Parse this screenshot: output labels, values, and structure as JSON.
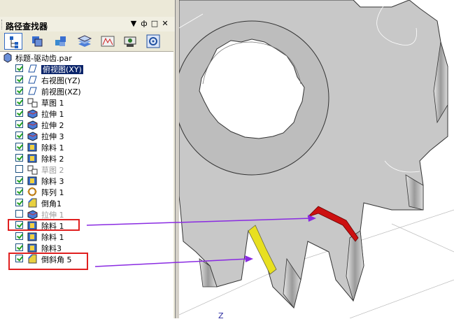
{
  "panel": {
    "title": "路径查找器",
    "title_buttons": [
      "▼",
      "ф",
      "□",
      "✕"
    ],
    "tools": [
      "feature-tree-icon",
      "layers-icon",
      "assembly-icon",
      "stack-icon",
      "variables-icon",
      "simulation-icon",
      "settings-icon"
    ]
  },
  "tree": {
    "root_label": "标题-驱动齿.par",
    "items": [
      {
        "label": "俯视图(XY)",
        "checked": true,
        "icon": "plane-icon",
        "selected": true,
        "dim": false
      },
      {
        "label": "右视图(YZ)",
        "checked": true,
        "icon": "plane-icon",
        "selected": false,
        "dim": false
      },
      {
        "label": "前视图(XZ)",
        "checked": true,
        "icon": "plane-icon",
        "selected": false,
        "dim": false
      },
      {
        "label": "草图 1",
        "checked": true,
        "icon": "sketch-icon",
        "selected": false,
        "dim": false
      },
      {
        "label": "拉伸 1",
        "checked": true,
        "icon": "extrude-icon",
        "selected": false,
        "dim": false
      },
      {
        "label": "拉伸 2",
        "checked": true,
        "icon": "extrude-icon",
        "selected": false,
        "dim": false
      },
      {
        "label": "拉伸 3",
        "checked": true,
        "icon": "extrude-icon",
        "selected": false,
        "dim": false
      },
      {
        "label": "除料 1",
        "checked": true,
        "icon": "cutout-icon",
        "selected": false,
        "dim": false
      },
      {
        "label": "除料 2",
        "checked": true,
        "icon": "cutout-icon",
        "selected": false,
        "dim": false
      },
      {
        "label": "草图 2",
        "checked": false,
        "icon": "sketch-icon",
        "selected": false,
        "dim": true
      },
      {
        "label": "除料 3",
        "checked": true,
        "icon": "cutout-icon",
        "selected": false,
        "dim": false
      },
      {
        "label": "阵列 1",
        "checked": true,
        "icon": "pattern-icon",
        "selected": false,
        "dim": false
      },
      {
        "label": "倒角1",
        "checked": true,
        "icon": "chamfer-icon",
        "selected": false,
        "dim": false
      },
      {
        "label": "拉伸 1",
        "checked": false,
        "icon": "extrude-icon",
        "selected": false,
        "dim": true
      },
      {
        "label": "除料 1",
        "checked": true,
        "icon": "cutout-icon",
        "selected": false,
        "dim": false
      },
      {
        "label": "除料 1",
        "checked": true,
        "icon": "cutout-icon",
        "selected": false,
        "dim": false
      },
      {
        "label": "除料3",
        "checked": true,
        "icon": "cutout-icon",
        "selected": false,
        "dim": false
      },
      {
        "label": "倒斜角 5",
        "checked": true,
        "icon": "chamfer-icon",
        "selected": false,
        "dim": false
      }
    ]
  },
  "viewport": {
    "axis_label": "Z",
    "highlight_red": "#cc1010",
    "highlight_yellow": "#e8e020",
    "gear_color": "#c8c8c8",
    "arrow_color": "#8a2be2"
  }
}
